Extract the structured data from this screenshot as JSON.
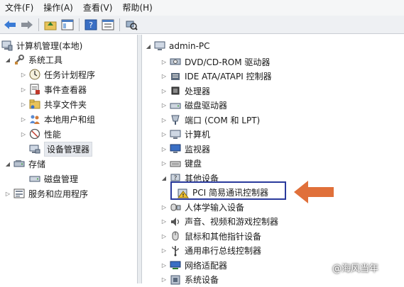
{
  "menu": [
    "文件(F)",
    "操作(A)",
    "查看(V)",
    "帮助(H)"
  ],
  "left_tree": {
    "root": "计算机管理(本地)",
    "system_tools": "系统工具",
    "task_scheduler": "任务计划程序",
    "event_viewer": "事件查看器",
    "shared_folders": "共享文件夹",
    "local_users": "本地用户和组",
    "performance": "性能",
    "device_manager": "设备管理器",
    "storage": "存储",
    "disk_management": "磁盘管理",
    "services_apps": "服务和应用程序"
  },
  "right_tree": {
    "root": "admin-PC",
    "items": [
      "DVD/CD-ROM 驱动器",
      "IDE ATA/ATAPI 控制器",
      "处理器",
      "磁盘驱动器",
      "端口 (COM 和 LPT)",
      "计算机",
      "监视器",
      "键盘",
      "其他设备",
      "PCI 简易通讯控制器",
      "人体学输入设备",
      "声音、视频和游戏控制器",
      "鼠标和其他指针设备",
      "通用串行总线控制器",
      "网络适配器",
      "系统设备"
    ]
  },
  "watermark": "@海风当年",
  "colors": {
    "highlight_border": "#2a3a9c",
    "arrow": "#e0703a"
  }
}
